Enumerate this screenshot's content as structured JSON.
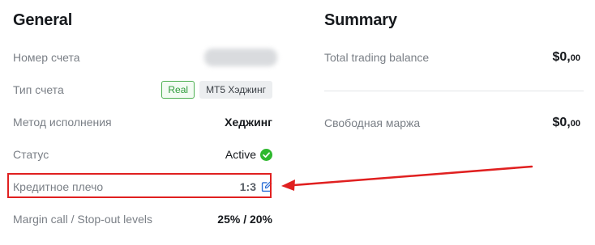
{
  "general": {
    "title": "General",
    "rows": {
      "account_number": {
        "label": "Номер счета"
      },
      "account_type": {
        "label": "Тип счета",
        "badge_real": "Real",
        "badge_type": "MT5 Хэджинг"
      },
      "execution_method": {
        "label": "Метод исполнения",
        "value": "Хеджинг"
      },
      "status": {
        "label": "Статус",
        "value": "Active",
        "icon": "check-circle-icon"
      },
      "leverage": {
        "label": "Кредитное плечо",
        "value": "1:3",
        "icon": "edit-icon"
      },
      "margin_levels": {
        "label": "Margin call / Stop-out levels",
        "value": "25% / 20%"
      }
    }
  },
  "summary": {
    "title": "Summary",
    "total_balance": {
      "label": "Total trading balance",
      "amount_main": "$0,",
      "amount_cents": "00"
    },
    "free_margin": {
      "label": "Свободная маржа",
      "amount_main": "$0,",
      "amount_cents": "00"
    }
  },
  "colors": {
    "highlight": "#e02020",
    "success": "#2eb82e",
    "link": "#2a6fd6"
  }
}
